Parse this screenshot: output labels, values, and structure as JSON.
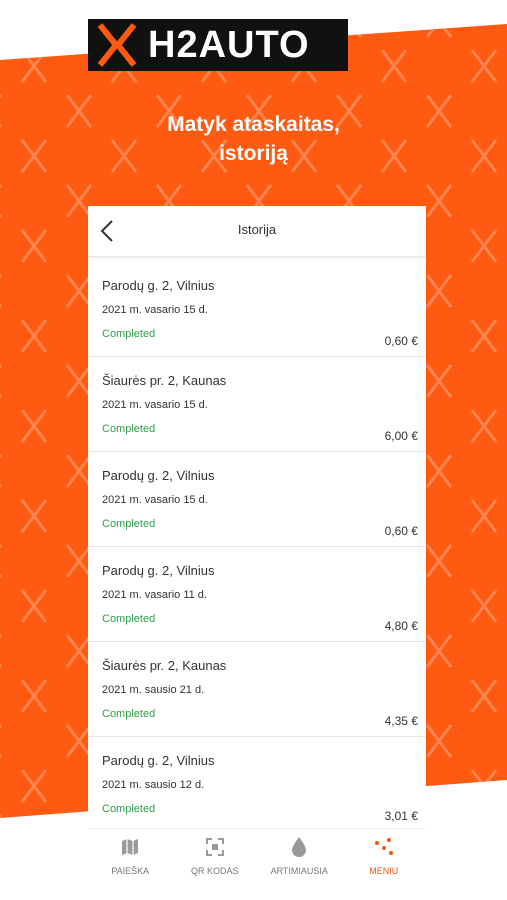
{
  "brand": {
    "logo_text": "H2AUTO",
    "accent_color": "#ff5a12"
  },
  "promo": {
    "line1": "Matyk ataskaitas,",
    "line2": "istoriją"
  },
  "screen": {
    "title": "Istorija"
  },
  "history": [
    {
      "address": "Parodų g. 2, Vilnius",
      "date": "2021 m. vasario 15 d.",
      "status": "Completed",
      "price": "0,60 €"
    },
    {
      "address": "Šiaurės pr. 2, Kaunas",
      "date": "2021 m. vasario 15 d.",
      "status": "Completed",
      "price": "6,00 €"
    },
    {
      "address": "Parodų g. 2, Vilnius",
      "date": "2021 m. vasario 15 d.",
      "status": "Completed",
      "price": "0,60 €"
    },
    {
      "address": "Parodų g. 2, Vilnius",
      "date": "2021 m. vasario 11 d.",
      "status": "Completed",
      "price": "4,80 €"
    },
    {
      "address": "Šiaurės pr. 2, Kaunas",
      "date": "2021 m. sausio 21 d.",
      "status": "Completed",
      "price": "4,35 €"
    },
    {
      "address": "Parodų g. 2, Vilnius",
      "date": "2021 m. sausio 12 d.",
      "status": "Completed",
      "price": "3,01 €"
    }
  ],
  "nav": [
    {
      "label": "PAIEŠKA",
      "icon": "map-icon"
    },
    {
      "label": "QR KODAS",
      "icon": "qr-scan-icon"
    },
    {
      "label": "ARTIMIAUSIA",
      "icon": "drop-icon"
    },
    {
      "label": "MENIU",
      "icon": "dots-menu-icon",
      "active": true
    }
  ]
}
